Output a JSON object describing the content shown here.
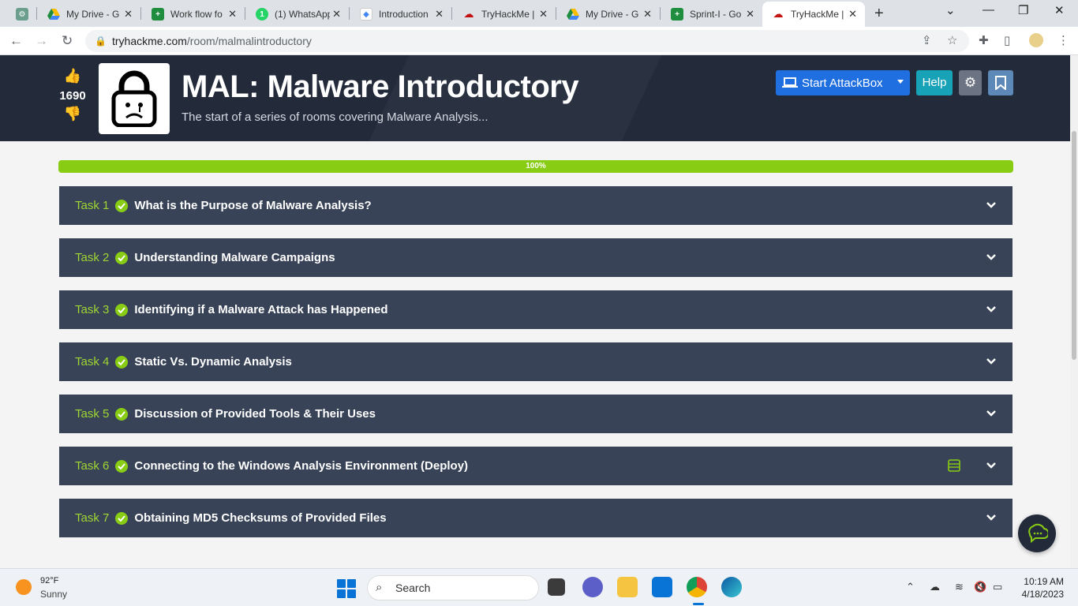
{
  "browser": {
    "tabs": [
      {
        "label": "",
        "icon": "chatgpt-icon",
        "color": "#6b9e8d"
      },
      {
        "label": "My Drive - G",
        "icon": "google-drive-icon",
        "color": "#f2b600"
      },
      {
        "label": "Work flow fo",
        "icon": "google-sheets-icon",
        "color": "#1e8e3e"
      },
      {
        "label": "(1) WhatsApp",
        "icon": "whatsapp-icon",
        "color": "#25d366"
      },
      {
        "label": "Introduction",
        "icon": "google-slides-icon",
        "color": "#4285f4"
      },
      {
        "label": "TryHackMe |",
        "icon": "tryhackme-icon",
        "color": "#c11111"
      },
      {
        "label": "My Drive - G",
        "icon": "google-drive-icon",
        "color": "#f2b600"
      },
      {
        "label": "Sprint-I - Go",
        "icon": "google-sheets-icon",
        "color": "#1e8e3e"
      },
      {
        "label": "TryHackMe |",
        "icon": "tryhackme-icon",
        "color": "#c11111"
      }
    ],
    "url_domain": "tryhackme.com",
    "url_path": "/room/malmalintroductory"
  },
  "room": {
    "likes": "1690",
    "title": "MAL: Malware Introductory",
    "subtitle": "The start of a series of rooms covering Malware Analysis...",
    "start_attackbox": "Start AttackBox",
    "help": "Help",
    "progress_label": "100%",
    "progress_value": 100
  },
  "tasks": [
    {
      "num": "Task 1",
      "title": "What is the Purpose of Malware Analysis?",
      "deploy": false
    },
    {
      "num": "Task 2",
      "title": "Understanding Malware Campaigns",
      "deploy": false
    },
    {
      "num": "Task 3",
      "title": "Identifying if a Malware Attack has Happened",
      "deploy": false
    },
    {
      "num": "Task 4",
      "title": "Static Vs. Dynamic Analysis",
      "deploy": false
    },
    {
      "num": "Task 5",
      "title": "Discussion of Provided Tools & Their Uses",
      "deploy": false
    },
    {
      "num": "Task 6",
      "title": "Connecting to the Windows Analysis Environment (Deploy)",
      "deploy": true
    },
    {
      "num": "Task 7",
      "title": "Obtaining MD5 Checksums of Provided Files",
      "deploy": false
    }
  ],
  "taskbar": {
    "temperature": "92°F",
    "weather": "Sunny",
    "search": "Search",
    "time": "10:19 AM",
    "date": "4/18/2023"
  },
  "colors": {
    "accent_green": "#88cc14",
    "hero_bg": "#232b3b",
    "task_bg": "#384358",
    "attackbox_blue": "#1f6fe0",
    "help_teal": "#18a2b8"
  }
}
